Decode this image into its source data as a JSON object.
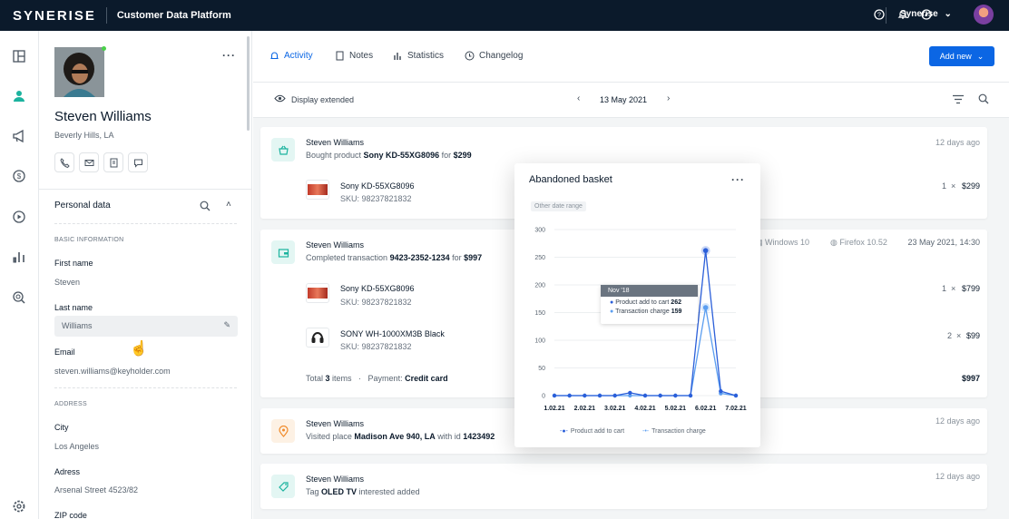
{
  "topbar": {
    "logo": "SYNERISE",
    "app_title": "Customer Data Platform",
    "workspace": "Synerise"
  },
  "profile": {
    "name": "Steven Williams",
    "location": "Beverly Hills, LA",
    "personal_data_title": "Personal data",
    "basic_info": "BASIC INFORMATION",
    "fields": [
      {
        "label": "First name",
        "value": "Steven"
      },
      {
        "label": "Last name",
        "value": "Williams"
      },
      {
        "label": "Email",
        "value": "steven.williams@keyholder.com"
      }
    ],
    "address_title": "ADDRESS",
    "address_fields": [
      {
        "label": "City",
        "value": "Los Angeles"
      },
      {
        "label": "Adress",
        "value": "Arsenal Street 4523/82"
      },
      {
        "label": "ZIP code",
        "value": ""
      }
    ]
  },
  "tabs": [
    {
      "label": "Activity",
      "active": true
    },
    {
      "label": "Notes"
    },
    {
      "label": "Statistics"
    },
    {
      "label": "Changelog"
    }
  ],
  "add_new": "Add new",
  "datebar": {
    "toggle": "Display extended",
    "date": "13 May 2021"
  },
  "activities": [
    {
      "name": "Steven Williams",
      "desc_pre": "Bought product ",
      "desc_bold": "Sony KD-55XG8096",
      "desc_mid": " for ",
      "desc_bold2": "$299",
      "ago": "12 days ago",
      "products": [
        {
          "name": "Sony KD-55XG8096",
          "sku": "SKU: 98237821832",
          "qty": "1",
          "price": "$299"
        }
      ]
    },
    {
      "name": "Steven Williams",
      "desc_pre": "Completed transaction ",
      "desc_bold": "9423-2352-1234",
      "desc_mid": " for ",
      "desc_bold2": "$997",
      "os": "Windows 10",
      "browser": "Firefox 10.52",
      "ago": "23 May 2021, 14:30",
      "products": [
        {
          "name": "Sony KD-55XG8096",
          "sku": "SKU: 98237821832",
          "qty": "1",
          "price": "$799"
        },
        {
          "name": "SONY WH-1000XM3B Black",
          "sku": "SKU: 98237821832",
          "qty": "2",
          "price": "$99"
        }
      ],
      "total_pre": "Total ",
      "total_bold": "3",
      "total_post": " items",
      "payment_pre": "Payment: ",
      "payment": "Credit card",
      "total_price": "$997"
    },
    {
      "name": "Steven Williams",
      "desc_pre": "Visited place ",
      "desc_bold": "Madison Ave 940, LA",
      "desc_mid": " with id ",
      "desc_bold2": "1423492",
      "ago": "12 days ago"
    },
    {
      "name": "Steven Williams",
      "desc_pre": "Tag ",
      "desc_bold": "OLED TV",
      "desc_mid": " interested added",
      "desc_bold2": "",
      "ago": "12 days ago"
    }
  ],
  "popup": {
    "title": "Abandoned basket",
    "chip": "Other date range",
    "tooltip": {
      "header": "Nov '18",
      "rows": [
        {
          "label": "Product add to cart",
          "value": "262"
        },
        {
          "label": "Transaction charge",
          "value": "159"
        }
      ]
    }
  },
  "chart_data": {
    "type": "line",
    "categories": [
      "1.02.21",
      "",
      "2.02.21",
      "",
      "3.02.21",
      "",
      "4.02.21",
      "",
      "5.02.21",
      "",
      "6.02.21",
      "",
      "7.02.21"
    ],
    "x_tick_labels": [
      "1.02.21",
      "2.02.21",
      "3.02.21",
      "4.02.21",
      "5.02.21",
      "6.02.21",
      "7.02.21"
    ],
    "ylim": [
      0,
      300
    ],
    "yticks": [
      0,
      50,
      100,
      150,
      200,
      250,
      300
    ],
    "series": [
      {
        "name": "Product add to cart",
        "color": "#2b5fd9",
        "values": [
          0,
          0,
          0,
          0,
          0,
          5,
          0,
          0,
          0,
          0,
          262,
          8,
          0
        ]
      },
      {
        "name": "Transaction charge",
        "color": "#5b9ef0",
        "values": [
          0,
          0,
          0,
          0,
          0,
          0,
          0,
          0,
          0,
          0,
          159,
          4,
          0
        ]
      }
    ],
    "legend": "bottom",
    "grid": true
  }
}
